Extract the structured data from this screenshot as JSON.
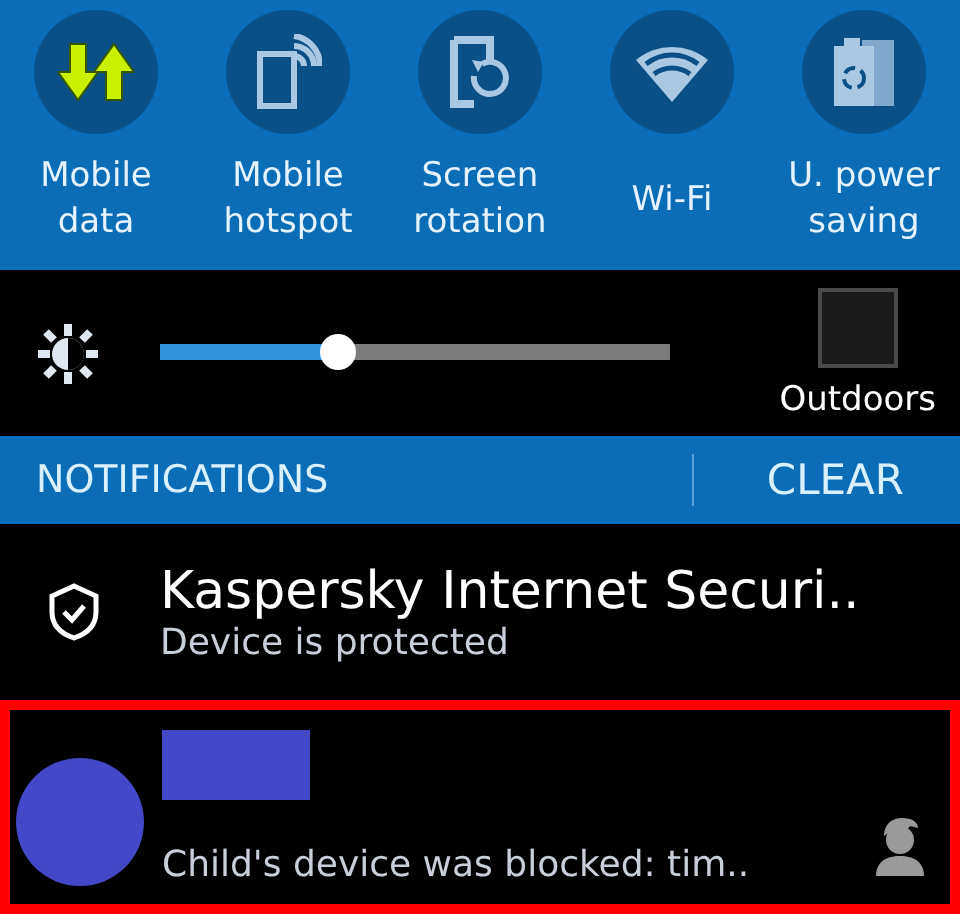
{
  "quick_settings": [
    {
      "label_lines": [
        "Mobile",
        "data"
      ],
      "on": true
    },
    {
      "label_lines": [
        "Mobile",
        "hotspot"
      ],
      "on": false
    },
    {
      "label_lines": [
        "Screen",
        "rotation"
      ],
      "on": false
    },
    {
      "label_lines": [
        "Wi-Fi"
      ],
      "on": false
    },
    {
      "label_lines": [
        "U. power",
        "saving"
      ],
      "on": false
    }
  ],
  "brightness": {
    "level": 0.35,
    "outdoors": {
      "label": "Outdoors",
      "checked": false
    }
  },
  "notifications_header": {
    "title": "NOTIFICATIONS",
    "clear": "CLEAR"
  },
  "notifications": [
    {
      "kind": "app",
      "title": "Kaspersky Internet Securi..",
      "text": "Device is protected",
      "highlighted": false
    },
    {
      "kind": "redacted",
      "text": "Child's device was blocked: tim..",
      "highlighted": true
    }
  ]
}
